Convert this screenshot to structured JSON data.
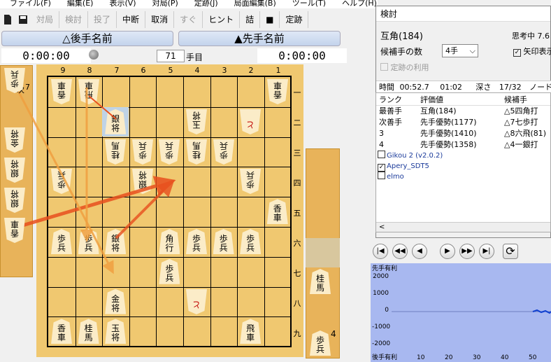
{
  "menu": [
    "ファイル(F)",
    "編集(E)",
    "表示(V)",
    "対局(P)",
    "定跡(J)",
    "局面編集(B)",
    "ツール(T)",
    "ヘルプ(H)"
  ],
  "toolbar": {
    "b1": "対局",
    "b2": "検討",
    "b3": "投了",
    "b4": "中断",
    "b5": "取消",
    "b6": "すぐ",
    "b7": "ヒント",
    "b8": "詰",
    "b9": "定跡"
  },
  "players": {
    "gote": "△後手名前",
    "sente": "▲先手名前",
    "gote_time": "0:00:00",
    "sente_time": "0:00:00"
  },
  "move": {
    "number": "71",
    "unit": "手目"
  },
  "files": [
    "9",
    "8",
    "7",
    "6",
    "5",
    "4",
    "3",
    "2",
    "1"
  ],
  "ranks": [
    "一",
    "二",
    "三",
    "四",
    "五",
    "六",
    "七",
    "八",
    "九"
  ],
  "panel": {
    "title": "検討",
    "move": "互角(184)",
    "thinking": "思考中 7.6",
    "cand_label": "候補手の数",
    "cand_value": "4手",
    "arrow_label": "矢印表示",
    "joseki": "定跡の利用",
    "time_label": "時間",
    "time_val": "00:52.7",
    "time_val2": "01:02",
    "depth_label": "深さ",
    "depth_val": "17/32",
    "node_label": "ノード",
    "headers": [
      "ランク",
      "評価値",
      "候補手"
    ],
    "rows": [
      [
        "最善手",
        "互角(184)",
        "△5四角打"
      ],
      [
        "次善手",
        "先手優勢(1177)",
        "△7七歩打"
      ],
      [
        "3",
        "先手優勢(1410)",
        "△8六飛(81)"
      ],
      [
        "4",
        "先手優勢(1358)",
        "△4一銀打"
      ]
    ],
    "engines": [
      {
        "name": "Gikou 2 (v2.0.2)",
        "checked": false
      },
      {
        "name": "Apery_SDT5",
        "checked": true
      },
      {
        "name": "elmo",
        "checked": false
      }
    ]
  },
  "graph": {
    "title": "先手有利",
    "bottom": "後手有利",
    "y": [
      "2000",
      "1000",
      "0",
      "-1000",
      "-2000"
    ],
    "x": [
      "10",
      "20",
      "30",
      "40",
      "50"
    ]
  },
  "stand_gote": [
    [
      "歩",
      "兵"
    ],
    [
      "金",
      "将"
    ],
    [
      "銀",
      "将"
    ],
    [
      "銀",
      "将"
    ],
    [
      "香",
      "車"
    ]
  ],
  "stand_sente": [
    [
      "桂",
      "馬"
    ],
    [
      "歩",
      "兵"
    ]
  ],
  "stand_labels": {
    "gote_top": "7",
    "sente_count": "4",
    "next": "次",
    "best": "最"
  },
  "colors": {
    "highlight": "#bfd3e6",
    "arrow": "#e8501e",
    "arrow2": "#f0a040"
  }
}
